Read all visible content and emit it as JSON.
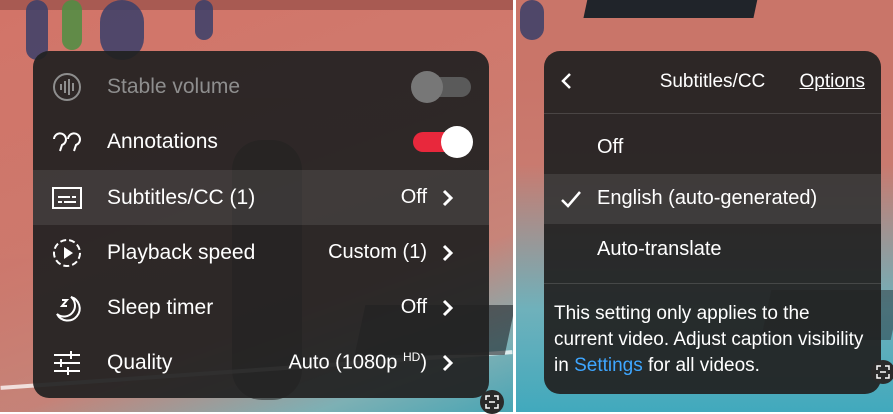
{
  "left_menu": {
    "items": [
      {
        "label": "Stable volume",
        "icon": "stable-volume-icon",
        "toggle": false,
        "disabled": true
      },
      {
        "label": "Annotations",
        "icon": "annotations-icon",
        "toggle": true
      },
      {
        "label": "Subtitles/CC (1)",
        "icon": "subtitles-icon",
        "value": "Off"
      },
      {
        "label": "Playback speed",
        "icon": "playback-speed-icon",
        "value": "Custom (1)"
      },
      {
        "label": "Sleep timer",
        "icon": "sleep-timer-icon",
        "value": "Off"
      },
      {
        "label": "Quality",
        "icon": "quality-icon",
        "value": "Auto (1080p",
        "value_sup": "HD",
        "value_close": ")"
      }
    ]
  },
  "right_panel": {
    "title": "Subtitles/CC",
    "options_label": "Options",
    "options": [
      {
        "label": "Off",
        "selected": false
      },
      {
        "label": "English (auto-generated)",
        "selected": true
      },
      {
        "label": "Auto-translate",
        "selected": false
      }
    ],
    "note_before": "This setting only applies to the current video. Adjust caption visibility in ",
    "note_link": "Settings",
    "note_after": " for all videos."
  },
  "colors": {
    "panel_bg": "#212121",
    "toggle_on": "#e8283c",
    "link": "#3ea6ff",
    "court_red": "#cf7a6e",
    "court_blue": "#41a9bd"
  }
}
